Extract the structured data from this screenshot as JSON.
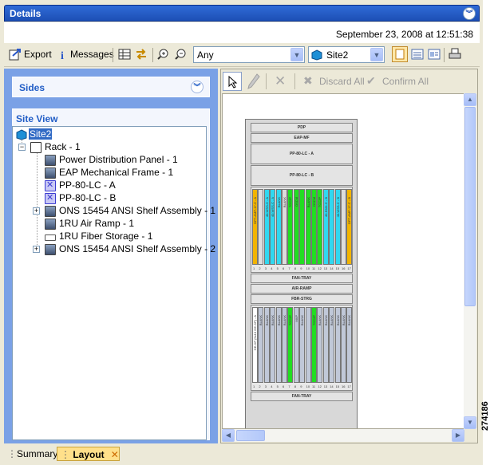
{
  "window": {
    "title": "Details",
    "timestamp": "September 23, 2008 at 12:51:38"
  },
  "toolbar": {
    "export_label": "Export",
    "messages_label": "Messages",
    "filter_value": "Any",
    "site_value": "Site2"
  },
  "sides": {
    "title": "Sides"
  },
  "site_view": {
    "title": "Site View",
    "root": "Site2",
    "rack": "Rack - 1",
    "items": [
      "Power Distribution Panel - 1",
      "EAP Mechanical Frame - 1",
      "PP-80-LC - A",
      "PP-80-LC - B",
      "ONS 15454 ANSI Shelf Assembly - 1",
      "1RU Air Ramp - 1",
      "1RU Fiber Storage - 1",
      "ONS 15454 ANSI Shelf Assembly - 2"
    ]
  },
  "layout_toolbar": {
    "discard_label": "Discard All",
    "confirm_label": "Confirm All"
  },
  "rack": {
    "bays": {
      "pdp": "PDP",
      "eap": "EAP-MF",
      "pp_a": "PP-80-LC - A",
      "pp_b": "PP-80-LC - B",
      "fan1": "FAN-TRAY",
      "air": "AIR-RAMP",
      "fbr": "FBR-STRG",
      "fan2": "FAN-TRAY"
    },
    "slot_numbers": [
      "1",
      "2",
      "3",
      "4",
      "5",
      "6",
      "7",
      "8",
      "9",
      "10",
      "11",
      "12",
      "13",
      "14",
      "15",
      "16",
      "17"
    ],
    "shelf1_slots": [
      {
        "label": "OPT-AMP-17-C - A",
        "color": "#f2b400"
      },
      {
        "label": "",
        "color": "#dddddd"
      },
      {
        "label": "40-WSS-C - A",
        "color": "#30d8f0"
      },
      {
        "label": "40-WSS-C - A",
        "color": "#30d8f0"
      },
      {
        "label": "BLANK",
        "color": "#30d8f0"
      },
      {
        "label": "BLANK",
        "color": "#dddddd"
      },
      {
        "label": "TCC2P",
        "color": "#22dd22"
      },
      {
        "label": "OSCM",
        "color": "#22dd22"
      },
      {
        "label": "",
        "color": "#22dd22"
      },
      {
        "label": "BLANK",
        "color": "#22dd22"
      },
      {
        "label": "OSCM",
        "color": "#22dd22"
      },
      {
        "label": "TCC2P",
        "color": "#22dd22"
      },
      {
        "label": "40-DMX-C - B",
        "color": "#30d8f0"
      },
      {
        "label": "",
        "color": "#30d8f0"
      },
      {
        "label": "40-WSS-C - B",
        "color": "#30d8f0"
      },
      {
        "label": "",
        "color": "#dddddd"
      },
      {
        "label": "OPT-AMP-17-C - B",
        "color": "#f2b400"
      }
    ],
    "shelf2_slots": [
      {
        "label": "GE-XP (5x10 GE-XP) - A",
        "color": "#ffffff"
      },
      {
        "label": "BLANK",
        "color": "#c0c8d8"
      },
      {
        "label": "BLANK",
        "color": "#c0c8d8"
      },
      {
        "label": "BLANK",
        "color": "#c0c8d8"
      },
      {
        "label": "BLANK",
        "color": "#c0c8d8"
      },
      {
        "label": "BLANK",
        "color": "#c0c8d8"
      },
      {
        "label": "TCC2P",
        "color": "#22dd22"
      },
      {
        "label": "MXP",
        "color": "#c0c8d8"
      },
      {
        "label": "BLANK",
        "color": "#c0c8d8"
      },
      {
        "label": "",
        "color": "#c0c8d8"
      },
      {
        "label": "TCC2P",
        "color": "#22dd22"
      },
      {
        "label": "BLANK",
        "color": "#c0c8d8"
      },
      {
        "label": "BLANK",
        "color": "#c0c8d8"
      },
      {
        "label": "BLANK",
        "color": "#c0c8d8"
      },
      {
        "label": "BLANK",
        "color": "#c0c8d8"
      },
      {
        "label": "BLANK",
        "color": "#c0c8d8"
      },
      {
        "label": "BLANK",
        "color": "#c0c8d8"
      }
    ]
  },
  "tabs": {
    "summary": "Summary",
    "layout": "Layout"
  },
  "figure_number": "274186"
}
